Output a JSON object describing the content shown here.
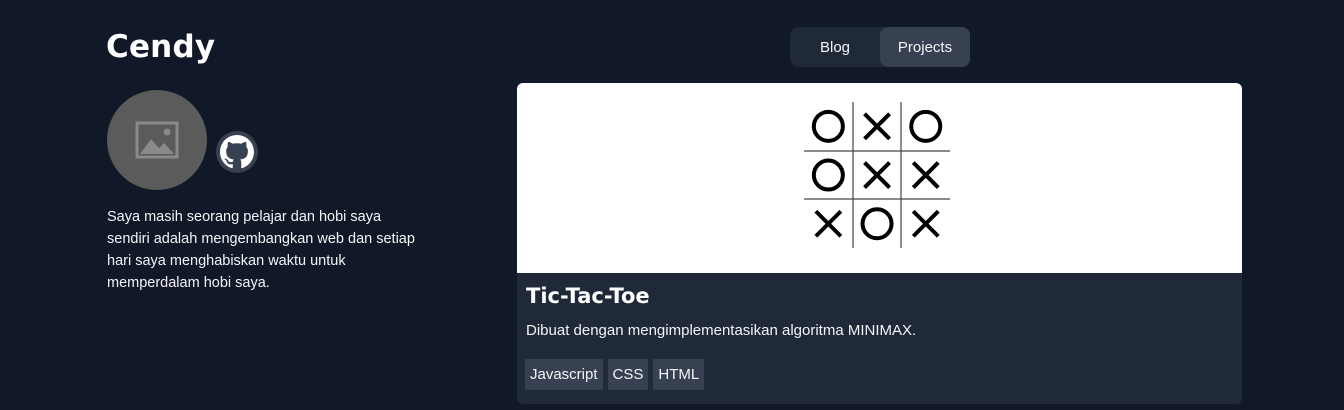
{
  "site": {
    "brand": "Cendy",
    "bio": "Saya masih seorang pelajar dan hobi saya sendiri adalah mengembangkan web dan setiap hari saya menghabiskan waktu untuk memperdalam hobi saya.",
    "avatar_icon": "image-placeholder-icon",
    "social_icon": "github-icon"
  },
  "nav": {
    "tabs": [
      {
        "label": "Blog",
        "active": false
      },
      {
        "label": "Projects",
        "active": true
      }
    ]
  },
  "project": {
    "title": "Tic-Tac-Toe",
    "description": "Dibuat dengan mengimplementasikan algoritma MINIMAX.",
    "tags": [
      "Javascript",
      "CSS",
      "HTML"
    ],
    "board": [
      [
        "O",
        "X",
        "O"
      ],
      [
        "O",
        "X",
        "X"
      ],
      [
        "X",
        "O",
        "X"
      ]
    ]
  },
  "colors": {
    "background": "#111827",
    "surface": "#1f2937",
    "accent_surface": "#374151",
    "text": "#f3f4f6"
  }
}
